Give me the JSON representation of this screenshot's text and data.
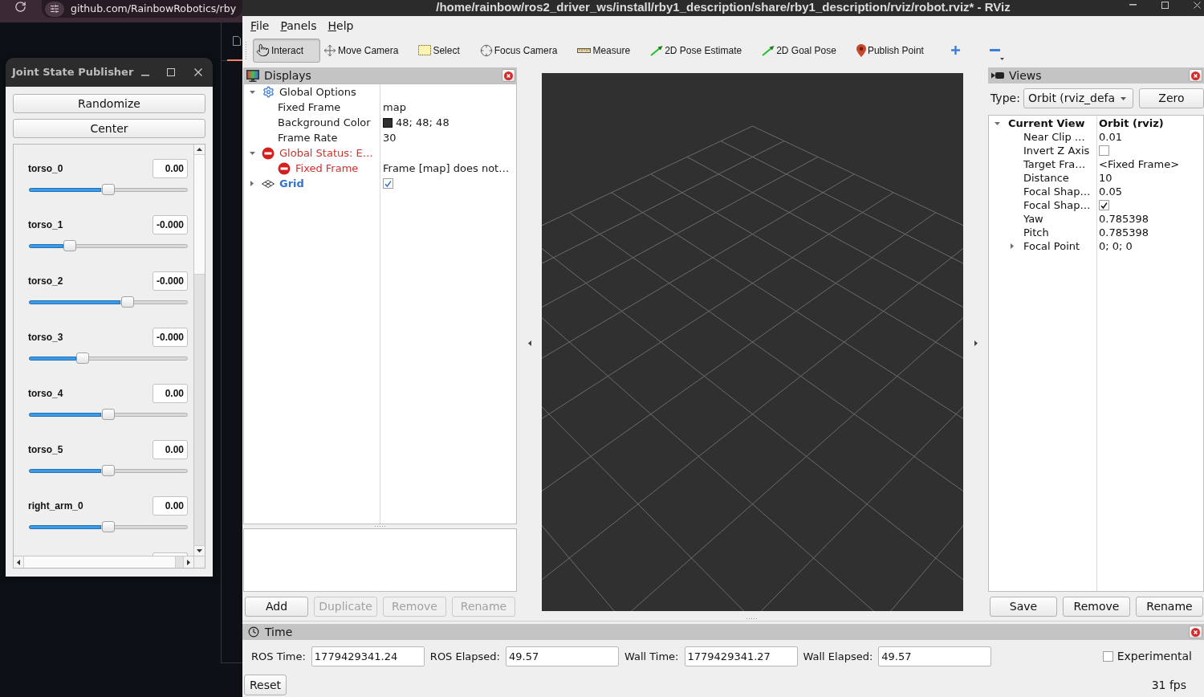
{
  "browser": {
    "address": "github.com/RainbowRobotics/rby"
  },
  "joint_state_publisher": {
    "title": "Joint State Publisher",
    "buttons": [
      "Randomize",
      "Center"
    ],
    "joints": [
      {
        "name": "torso_0",
        "value": "0.00",
        "level": 0.5
      },
      {
        "name": "torso_1",
        "value": "-0.000",
        "level": 0.26
      },
      {
        "name": "torso_2",
        "value": "-0.000",
        "level": 0.62
      },
      {
        "name": "torso_3",
        "value": "-0.000",
        "level": 0.34
      },
      {
        "name": "torso_4",
        "value": "0.00",
        "level": 0.5
      },
      {
        "name": "torso_5",
        "value": "0.00",
        "level": 0.5
      },
      {
        "name": "right_arm_0",
        "value": "0.00",
        "level": 0.5
      }
    ]
  },
  "rviz": {
    "title": "/home/rainbow/ros2_driver_ws/install/rby1_description/share/rby1_description/rviz/robot.rviz* - RViz",
    "menu": [
      "File",
      "Panels",
      "Help"
    ],
    "toolbar": {
      "tools": [
        {
          "kind": "interact",
          "label": "Interact",
          "selected": true
        },
        {
          "kind": "move_camera",
          "label": "Move Camera",
          "selected": false
        },
        {
          "kind": "select",
          "label": "Select",
          "selected": false
        },
        {
          "kind": "focus_camera",
          "label": "Focus Camera",
          "selected": false
        },
        {
          "kind": "measure",
          "label": "Measure",
          "selected": false
        },
        {
          "kind": "pose_estimate",
          "label": "2D Pose Estimate",
          "selected": false
        },
        {
          "kind": "goal_pose",
          "label": "2D Goal Pose",
          "selected": false
        },
        {
          "kind": "publish_point",
          "label": "Publish Point",
          "selected": false
        }
      ],
      "actions": [
        {
          "kind": "add_tool"
        },
        {
          "kind": "remove_tool"
        }
      ]
    },
    "displays": {
      "title": "Displays",
      "tree": [
        {
          "kind": "global_options",
          "label": "Global Options",
          "expanded": true,
          "children": [
            {
              "kind": "text",
              "label": "Fixed Frame",
              "value": "map"
            },
            {
              "kind": "color",
              "label": "Background Color",
              "value": "48; 48; 48",
              "color": "#303030"
            },
            {
              "kind": "text",
              "label": "Frame Rate",
              "value": "30"
            }
          ]
        },
        {
          "kind": "status_error",
          "label": "Global Status: E…",
          "expanded": true,
          "children": [
            {
              "kind": "status_error",
              "label": "Fixed Frame",
              "value": "Frame [map] does not…"
            }
          ]
        },
        {
          "kind": "grid",
          "label": "Grid",
          "expanded": false,
          "checked": true
        }
      ],
      "buttons": [
        {
          "label": "Add",
          "disabled": false
        },
        {
          "label": "Duplicate",
          "disabled": true
        },
        {
          "label": "Remove",
          "disabled": true
        },
        {
          "label": "Rename",
          "disabled": true
        }
      ]
    },
    "views": {
      "title": "Views",
      "type_label": "Type:",
      "type_value": "Orbit (rviz_defa",
      "zero_button": "Zero",
      "tree": [
        {
          "kind": "view",
          "label": "Current View",
          "value": "Orbit (rviz)",
          "expanded": true,
          "children": [
            {
              "kind": "text",
              "label": "Near Clip …",
              "value": "0.01"
            },
            {
              "kind": "checkbox",
              "label": "Invert Z Axis",
              "checked": false
            },
            {
              "kind": "text",
              "label": "Target Fra…",
              "value": "<Fixed Frame>"
            },
            {
              "kind": "text",
              "label": "Distance",
              "value": "10"
            },
            {
              "kind": "text",
              "label": "Focal Shap…",
              "value": "0.05"
            },
            {
              "kind": "checkbox",
              "label": "Focal Shap…",
              "checked": true
            },
            {
              "kind": "text",
              "label": "Yaw",
              "value": "0.785398"
            },
            {
              "kind": "text",
              "label": "Pitch",
              "value": "0.785398"
            },
            {
              "kind": "group",
              "label": "Focal Point",
              "value": "0; 0; 0",
              "expanded": false
            }
          ]
        }
      ],
      "buttons": [
        "Save",
        "Remove",
        "Rename"
      ]
    },
    "time": {
      "title": "Time",
      "fields": [
        {
          "label": "ROS Time:",
          "value": "1779429341.24"
        },
        {
          "label": "ROS Elapsed:",
          "value": "49.57"
        },
        {
          "label": "Wall Time:",
          "value": "1779429341.27"
        },
        {
          "label": "Wall Elapsed:",
          "value": "49.57"
        }
      ],
      "experimental": {
        "label": "Experimental",
        "checked": false
      },
      "reset_button": "Reset",
      "fps": "31 fps"
    }
  }
}
